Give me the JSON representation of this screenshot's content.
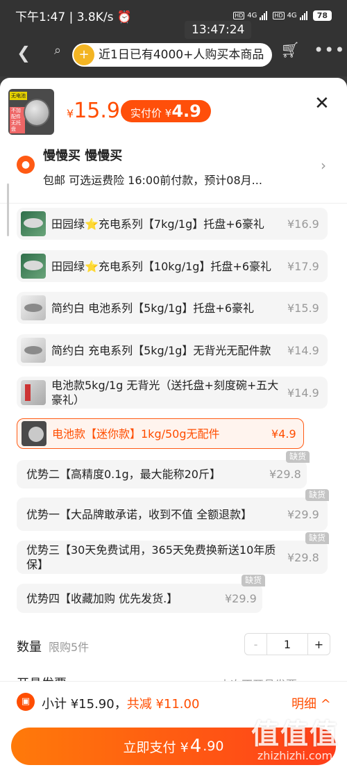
{
  "status_bar": {
    "time_speed": "下午1:47 | 3.8K/s ⏰",
    "network": "4G",
    "battery": "78"
  },
  "clock_overlay": "13:47:24",
  "nav": {
    "back_icon": "back-arrow-icon",
    "search_icon": "search-icon",
    "promo_text": "近1日已有4000+人购买本商品",
    "cart_icon": "cart-icon",
    "more_icon": "more-icon"
  },
  "product": {
    "price_symbol": "¥",
    "price": "15.9",
    "pay_label": "实付价 ¥",
    "pay_price": "4.9",
    "thumb_tag1": "无电池",
    "thumb_tag2": "不加配件无托盘"
  },
  "address": {
    "name": "慢慢买 慢慢买",
    "info": "包邮  可选运费险  16:00前付款，预计08月..."
  },
  "options": [
    {
      "label": "田园绿⭐充电系列【7kg/1g】托盘+6豪礼",
      "price": "¥16.9"
    },
    {
      "label": "田园绿⭐充电系列【10kg/1g】托盘+6豪礼",
      "price": "¥17.9"
    },
    {
      "label": "简约白  电池系列【5kg/1g】托盘+6豪礼",
      "price": "¥15.9"
    },
    {
      "label": "简约白  充电系列【5kg/1g】无背光无配件款",
      "price": "¥14.9"
    },
    {
      "label": "电池款5kg/1g 无背光（送托盘+刻度碗+五大豪礼）",
      "price": "¥14.9"
    },
    {
      "label": "电池款【迷你款】1kg/50g无配件",
      "price": "¥4.9"
    },
    {
      "label": "优势二【高精度0.1g，最大能称20斤】",
      "price": "¥29.8"
    },
    {
      "label": "优势一【大品牌敢承诺，收到不值 全额退款】",
      "price": "¥29.9"
    },
    {
      "label": "优势三【30天免费试用，365天免费换新送10年质保】",
      "price": "¥29.8"
    },
    {
      "label": "优势四【收藏加购 优先发货.】",
      "price": "¥29.9"
    }
  ],
  "out_of_stock_label": "缺货",
  "quantity": {
    "label": "数量",
    "limit": "限购5件",
    "minus": "-",
    "value": "1",
    "plus": "+"
  },
  "invoice": {
    "label": "开具发票",
    "value": "本次不开具发票 >"
  },
  "footer": {
    "subtotal_label": "小计 ¥15.90，",
    "discount": "共减 ¥11.00",
    "detail": "明细 ^",
    "pay_label": "立即支付 ¥",
    "pay_int": "4",
    "pay_dec": ".90"
  },
  "watermark": {
    "title": "值值值",
    "site": "zhizhizhi.com"
  },
  "colors": {
    "accent": "#ff4d00",
    "pill": "#ff4f0a",
    "disabled": "#999999"
  }
}
